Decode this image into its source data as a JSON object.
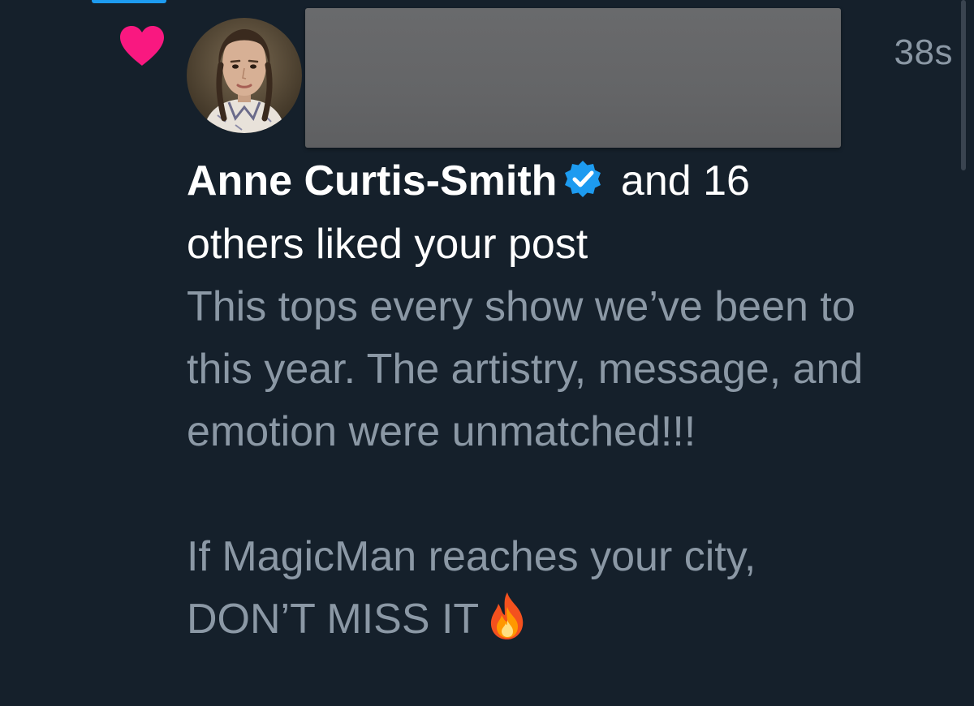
{
  "notification": {
    "type_icon": "heart-icon",
    "timestamp": "38s",
    "actor_name": "Anne Curtis-Smith",
    "verified_icon": "verified-badge-icon",
    "summary_rest_line1": "and 16",
    "summary_rest_line2": "others liked your post",
    "post_excerpt": {
      "line1": "This tops every show we’ve been to",
      "line2": "this year. The artistry, message, and",
      "line3": "emotion were unmatched!!!",
      "line4": "If MagicMan reaches your city,",
      "line5": "DON’T MISS IT"
    },
    "emoji_icon": "fire-icon"
  },
  "colors": {
    "background": "#15202b",
    "heart": "#f91880",
    "verified": "#1d9bf0",
    "primary_text": "#ffffff",
    "secondary_text": "#8b98a5",
    "redaction": "#666769"
  }
}
